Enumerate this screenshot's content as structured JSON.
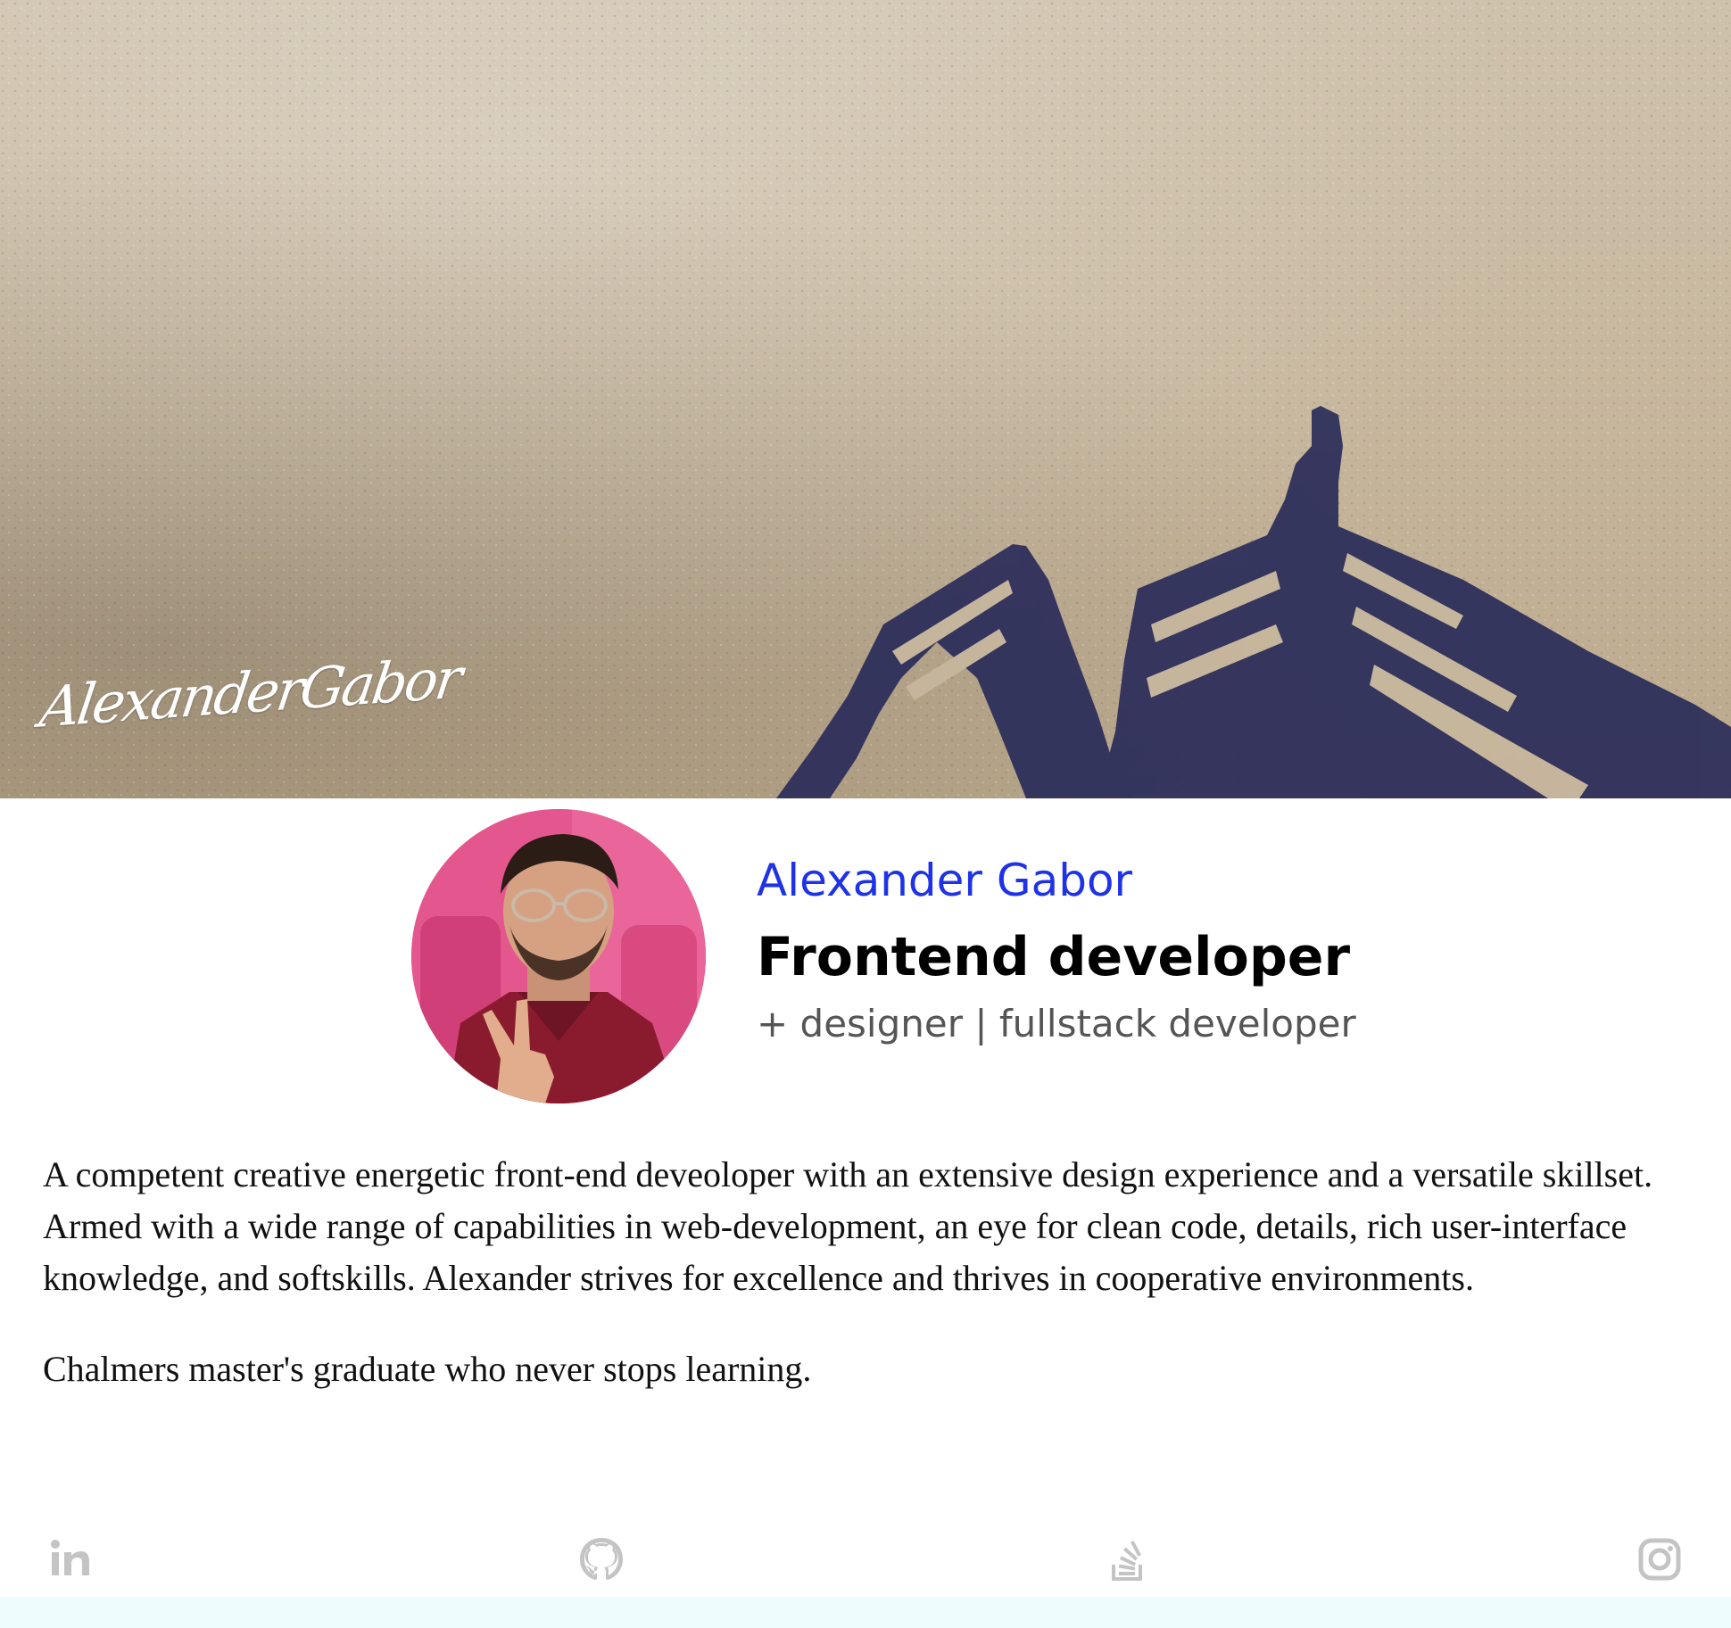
{
  "hero": {
    "signature": "AlexanderGabor"
  },
  "profile": {
    "name": "Alexander Gabor",
    "role": "Frontend developer",
    "subrole": "+ designer | fullstack developer",
    "avatar_icon": "profile-photo"
  },
  "bio": {
    "paragraph_1": "A competent creative energetic front-end deveoloper with an extensive design experience and a versatile skillset. Armed with a wide range of capabilities in web-development, an eye for clean code, details, rich user-interface knowledge, and softskills. Alexander strives for excellence and thrives in cooperative environments.",
    "paragraph_2": "Chalmers master's graduate who never stops learning."
  },
  "social": {
    "items": [
      {
        "icon": "linkedin-icon"
      },
      {
        "icon": "github-icon"
      },
      {
        "icon": "stackoverflow-icon"
      },
      {
        "icon": "instagram-icon"
      }
    ],
    "icon_color": "#c4c4c4"
  },
  "colors": {
    "name": "#1f33e6",
    "role": "#000000",
    "subrole": "#555555",
    "footer_bar": "#eefcfd",
    "avatar_bg": "#e2558c"
  }
}
